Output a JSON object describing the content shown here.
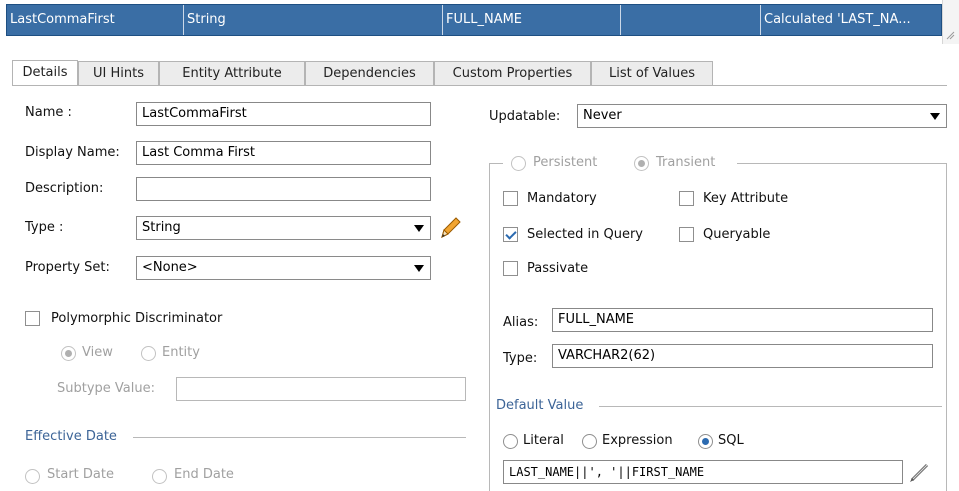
{
  "row": {
    "cells": [
      "LastCommaFirst",
      "String",
      "FULL_NAME",
      "",
      "Calculated 'LAST_NA..."
    ]
  },
  "tabs": [
    "Details",
    "UI Hints",
    "Entity Attribute",
    "Dependencies",
    "Custom Properties",
    "List of Values"
  ],
  "form": {
    "name_label": "Name :",
    "name_value": "LastCommaFirst",
    "display_name_label": "Display Name:",
    "display_name_value": "Last Comma First",
    "description_label": "Description:",
    "description_value": "",
    "type_label": "Type :",
    "type_value": "String",
    "property_set_label": "Property Set:",
    "property_set_value": "<None>",
    "polymorphic_label": "Polymorphic Discriminator",
    "view_label": "View",
    "entity_label": "Entity",
    "subtype_label": "Subtype Value:",
    "subtype_value": "",
    "effective_date_label": "Effective Date",
    "start_date_label": "Start Date",
    "end_date_label": "End Date"
  },
  "right": {
    "updatable_label": "Updatable:",
    "updatable_value": "Never",
    "persistent_label": "Persistent",
    "transient_label": "Transient",
    "mandatory_label": "Mandatory",
    "key_attribute_label": "Key Attribute",
    "selected_in_query_label": "Selected in Query",
    "queryable_label": "Queryable",
    "passivate_label": "Passivate",
    "alias_label": "Alias:",
    "alias_value": "FULL_NAME",
    "type_label": "Type:",
    "type_value": "VARCHAR2(62)",
    "default_value_label": "Default Value",
    "literal_label": "Literal",
    "expression_label": "Expression",
    "sql_label": "SQL",
    "sql_value": "LAST_NAME||', '||FIRST_NAME"
  },
  "colors": {
    "selection": "#3a6ea5",
    "accent": "#2b6ab0",
    "section_title": "#3c6497",
    "pencil": "#e07a00"
  },
  "icons": [
    "pencil-icon",
    "chevron-down-icon",
    "resize-grip-icon"
  ]
}
